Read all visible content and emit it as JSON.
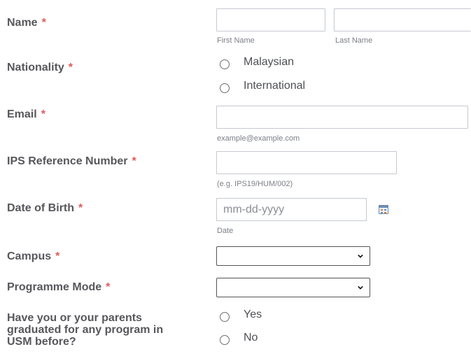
{
  "required_marker": "*",
  "name": {
    "label": "Name",
    "first_sublabel": "First Name",
    "last_sublabel": "Last Name"
  },
  "nationality": {
    "label": "Nationality",
    "options": [
      "Malaysian",
      "International"
    ]
  },
  "email": {
    "label": "Email",
    "sublabel": "example@example.com"
  },
  "ips": {
    "label": "IPS Reference Number",
    "sublabel": "(e.g. IPS19/HUM/002)"
  },
  "dob": {
    "label": "Date of Birth",
    "placeholder": "mm-dd-yyyy",
    "sublabel": "Date",
    "icon": "calendar-icon"
  },
  "campus": {
    "label": "Campus",
    "value": ""
  },
  "programme_mode": {
    "label": "Programme Mode",
    "value": ""
  },
  "alumni": {
    "label_lines": [
      "Have you or your parents",
      "graduated for any program in",
      "USM before?"
    ],
    "options": [
      "Yes",
      "No"
    ]
  },
  "colors": {
    "required": "#e45858",
    "label": "#57575c",
    "border": "#c5c9d1"
  }
}
